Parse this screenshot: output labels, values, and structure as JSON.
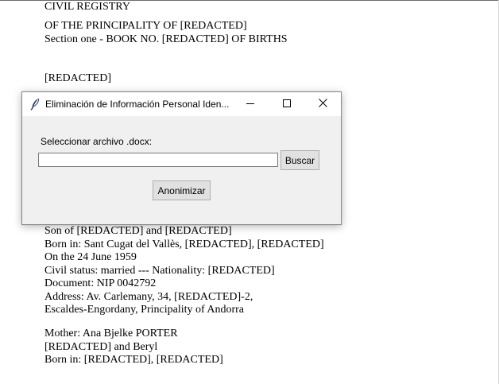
{
  "document": {
    "lines": [
      "CIVIL REGISTRY",
      "OF THE PRINCIPALITY OF [REDACTED]",
      "Section one - BOOK NO. [REDACTED] OF BIRTHS",
      "[REDACTED]",
      "Son of [REDACTED] and [REDACTED]",
      "Born in: Sant Cugat del Vallès, [REDACTED], [REDACTED]",
      "On the 24 June 1959",
      "Civil status: married --- Nationality: [REDACTED]",
      "Document: NIP 0042792",
      "Address: Av. Carlemany, 34, [REDACTED]-2,",
      "Escaldes-Engordany, Principality of Andorra",
      "Mother: Ana Bjelke PORTER",
      "[REDACTED] and Beryl",
      "Born in: [REDACTED], [REDACTED]"
    ]
  },
  "dialog": {
    "title": "Eliminación de Información Personal Iden...",
    "app_icon": "feather-icon",
    "controls": {
      "minimize_icon": "minimize-icon",
      "maximize_icon": "maximize-icon",
      "close_icon": "close-icon"
    },
    "file_label": "Seleccionar archivo .docx:",
    "file_value": "",
    "browse_label": "Buscar",
    "anonymize_label": "Anonimizar"
  }
}
